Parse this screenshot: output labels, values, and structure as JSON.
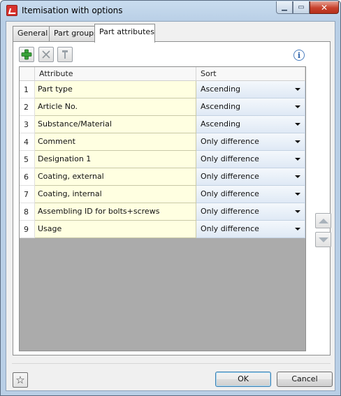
{
  "window": {
    "title": "Itemisation with options"
  },
  "tabs": [
    {
      "label": "General"
    },
    {
      "label": "Part groups"
    },
    {
      "label": "Part attributes"
    }
  ],
  "toolbar": {
    "add_icon": "green-plus-icon",
    "delete_icon": "delete-icon",
    "edit_icon": "pin-icon",
    "info_glyph": "i"
  },
  "grid": {
    "columns": [
      "Attribute",
      "Sort"
    ],
    "rows": [
      {
        "num": "1",
        "attribute": "Part type",
        "sort": "Ascending"
      },
      {
        "num": "2",
        "attribute": "Article No.",
        "sort": "Ascending"
      },
      {
        "num": "3",
        "attribute": "Substance/Material",
        "sort": "Ascending"
      },
      {
        "num": "4",
        "attribute": "Comment",
        "sort": "Only difference"
      },
      {
        "num": "5",
        "attribute": "Designation 1",
        "sort": "Only difference"
      },
      {
        "num": "6",
        "attribute": "Coating, external",
        "sort": "Only difference"
      },
      {
        "num": "7",
        "attribute": "Coating, internal",
        "sort": "Only difference"
      },
      {
        "num": "8",
        "attribute": "Assembling ID for bolts+screws",
        "sort": "Only difference"
      },
      {
        "num": "9",
        "attribute": "Usage",
        "sort": "Only difference"
      }
    ]
  },
  "footer": {
    "ok_label": "OK",
    "cancel_label": "Cancel",
    "favorite_glyph": "☆"
  },
  "colors": {
    "attribute_cell_bg": "#ffffe1",
    "sort_cell_bg": "#dfe9f5",
    "window_frame": "#b9cfe6",
    "close_button": "#c7412c"
  }
}
